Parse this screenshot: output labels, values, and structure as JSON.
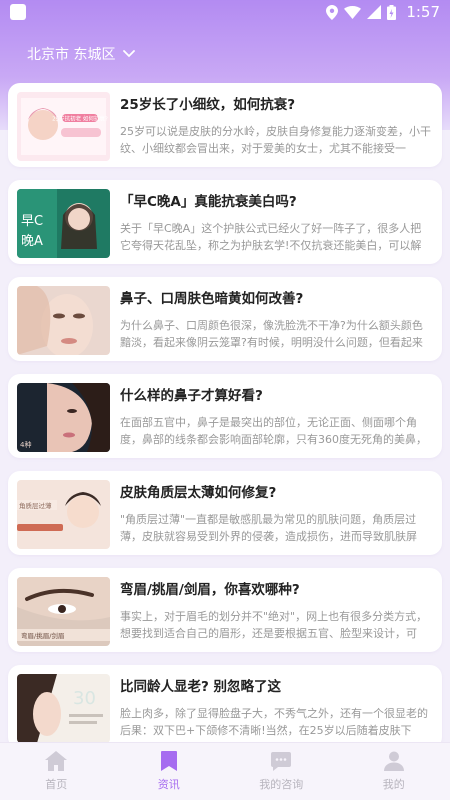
{
  "status_bar": {
    "time": "1:57",
    "icons": [
      "location-icon",
      "wifi-icon",
      "signal-icon",
      "battery-icon"
    ]
  },
  "header": {
    "location": "北京市 东城区"
  },
  "colors": {
    "accent": "#a66cf0",
    "header_top": "#b38bf2",
    "inactive_tab": "#b7b4bd"
  },
  "articles": [
    {
      "title": "25岁长了小细纹，如何抗衰?",
      "desc": "25岁可以说是皮肤的分水岭，皮肤自身修复能力逐渐变差，小干纹、小细纹都会冒出来，对于爱美的女士，尤其不能接受一",
      "thumb_text": "25岁抗初老 如何抗衰?"
    },
    {
      "title": "「早C晚A」真能抗衰美白吗?",
      "desc": "关于「早C晚A」这个护肤公式已经火了好一阵子了，很多人把它夸得天花乱坠，称之为护肤玄学!不仅抗衰还能美白，可以解",
      "thumb_text": "早C 晚A"
    },
    {
      "title": "鼻子、口周肤色暗黄如何改善?",
      "desc": "为什么鼻子、口周颜色很深，像洗脸洗不干净?为什么额头颜色黯淡，看起来像阴云笼罩?有时候，明明没什么问题，但看起来",
      "thumb_text": ""
    },
    {
      "title": "什么样的鼻子才算好看?",
      "desc": "在面部五官中，鼻子是最突出的部位，无论正面、侧面哪个角度，鼻部的线条都会影响面部轮廓，只有360度无死角的美鼻，",
      "thumb_text": ""
    },
    {
      "title": "皮肤角质层太薄如何修复?",
      "desc": "\"角质层过薄\"一直都是敏感肌最为常见的肌肤问题，角质层过薄，皮肤就容易受到外界的侵袭，造成损伤，进而导致肌肤屏",
      "thumb_text": "角质层过薄"
    },
    {
      "title": "弯眉/挑眉/剑眉，你喜欢哪种?",
      "desc": "事实上，对于眉毛的划分并不\"绝对\"，网上也有很多分类方式，想要找到适合自己的眉形，还是要根据五官、脸型来设计，可",
      "thumb_text": "弯眉/挑眉/剑眉"
    },
    {
      "title": "比同龄人显老? 别忽略了这",
      "desc": "脸上肉多，除了显得脸盘子大，不秀气之外，还有一个很显老的后果：双下巴+下颌修不清晰!当然，在25岁以后随着皮肤下",
      "thumb_text": ""
    }
  ],
  "tabbar": [
    {
      "label": "首页",
      "icon": "home-icon",
      "active": false
    },
    {
      "label": "资讯",
      "icon": "bookmark-icon",
      "active": true
    },
    {
      "label": "我的咨询",
      "icon": "chat-icon",
      "active": false
    },
    {
      "label": "我的",
      "icon": "user-icon",
      "active": false
    }
  ]
}
